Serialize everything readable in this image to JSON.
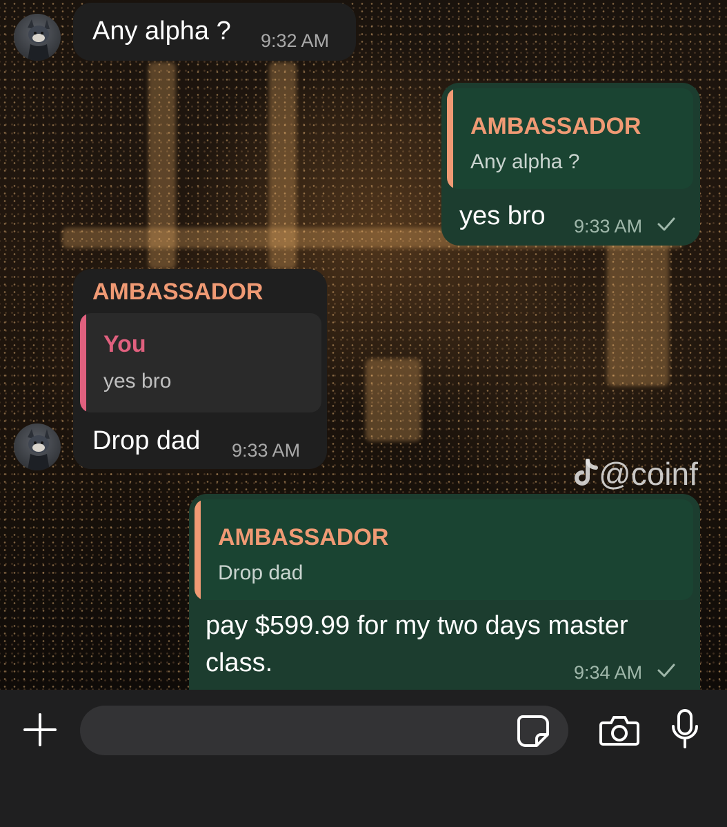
{
  "messages": [
    {
      "text": "Any alpha ?",
      "time": "9:32 AM"
    },
    {
      "reply_name": "AMBASSADOR",
      "reply_text": "Any alpha ?",
      "text": "yes bro",
      "time": "9:33 AM"
    },
    {
      "sender": "AMBASSADOR",
      "reply_name": "You",
      "reply_text": "yes bro",
      "text": "Drop dad",
      "time": "9:33 AM"
    },
    {
      "reply_name": "AMBASSADOR",
      "reply_text": "Drop dad",
      "text": "pay $599.99 for my two days master class.",
      "time": "9:34 AM"
    }
  ],
  "watermark": "@coinf",
  "composer": {
    "placeholder": ""
  },
  "colors": {
    "incoming_bubble": "#1f1f1f",
    "outgoing_bubble": "#1c3d2f",
    "sender_name": "#f09a74",
    "reply_you_name": "#e0607e",
    "composer_bg": "#1f1f20"
  },
  "icons": [
    "plus-icon",
    "sticker-icon",
    "camera-icon",
    "microphone-icon",
    "read-check-icon",
    "tiktok-logo-icon"
  ]
}
